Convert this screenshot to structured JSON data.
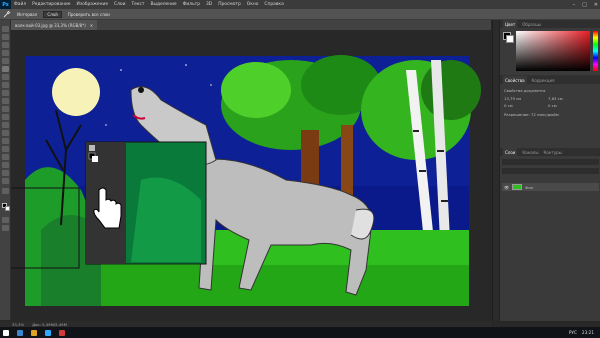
{
  "menubar": {
    "items": [
      "Файл",
      "Редактирование",
      "Изображение",
      "Слои",
      "Текст",
      "Выделение",
      "Фильтр",
      "3D",
      "Просмотр",
      "Окно",
      "Справка"
    ],
    "app_badge": "Ps",
    "window_controls": [
      "–",
      "□",
      "✕"
    ]
  },
  "options": {
    "ratio_label": "Интервал",
    "size_value": "Слой",
    "sample_label": "Проверить все слои"
  },
  "document": {
    "tab_title": "волк-вой-03.jpg @ 33,3% (RGB/8*)",
    "close": "✕"
  },
  "statusbar": {
    "zoom": "33,3%",
    "doc_info": "Док: 5,49M/5,49M"
  },
  "panels": {
    "color_tabs": [
      "Цвет",
      "Образцы"
    ],
    "properties_tabs": [
      "Свойства",
      "Коррекция"
    ],
    "properties_title": "Свойства документа",
    "prop_w": "13,79 см",
    "prop_h": "7,63 см",
    "prop_x": "0 см",
    "prop_y": "0 см",
    "resolution": "Разрешение: 72 пикс/дюйм",
    "layers_tabs": [
      "Слои",
      "Каналы",
      "Контуры"
    ],
    "layer_name": "Фон"
  },
  "taskbar": {
    "lang": "РУС",
    "time": "23:21"
  },
  "colors": {
    "accent_red": "#e81e25",
    "sky": "#0b1a8a",
    "grass": "#2fbf1f"
  }
}
